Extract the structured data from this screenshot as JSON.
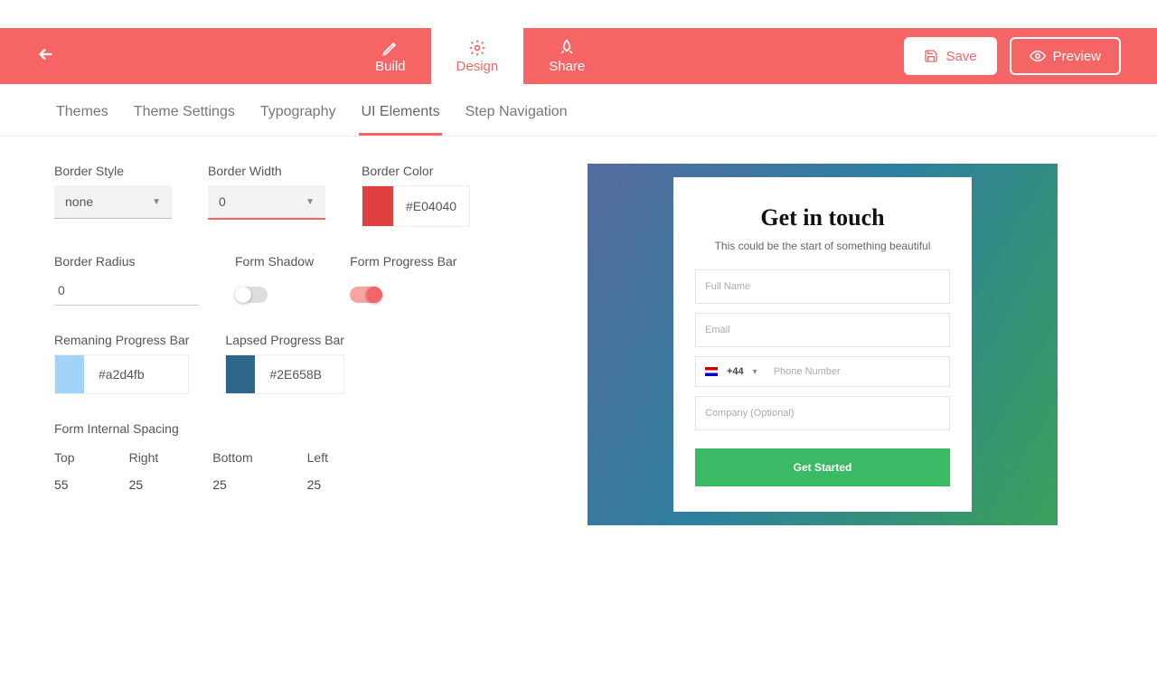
{
  "nav": {
    "tabs": {
      "build": "Build",
      "design": "Design",
      "share": "Share"
    },
    "save": "Save",
    "preview": "Preview"
  },
  "subnav": {
    "themes": "Themes",
    "theme_settings": "Theme Settings",
    "typography": "Typography",
    "ui_elements": "UI Elements",
    "step_navigation": "Step Navigation"
  },
  "fields": {
    "border_style": {
      "label": "Border Style",
      "value": "none"
    },
    "border_width": {
      "label": "Border Width",
      "value": "0"
    },
    "border_color": {
      "label": "Border Color",
      "hex": "#E04040",
      "swatch": "#e04040"
    },
    "border_radius": {
      "label": "Border Radius",
      "value": "0"
    },
    "form_shadow": {
      "label": "Form Shadow"
    },
    "form_progress": {
      "label": "Form Progress Bar"
    },
    "remaining_bar": {
      "label": "Remaning Progress Bar",
      "hex": "#a2d4fb",
      "swatch": "#a2d4fb"
    },
    "lapsed_bar": {
      "label": "Lapsed Progress Bar",
      "hex": "#2E658B",
      "swatch": "#2e658b"
    },
    "spacing": {
      "title": "Form Internal Spacing",
      "top": {
        "label": "Top",
        "value": "55"
      },
      "right": {
        "label": "Right",
        "value": "25"
      },
      "bottom": {
        "label": "Bottom",
        "value": "25"
      },
      "left": {
        "label": "Left",
        "value": "25"
      }
    }
  },
  "preview": {
    "title": "Get in touch",
    "subtitle": "This could be the start of something beautiful",
    "fullname": "Full Name",
    "email": "Email",
    "country_code": "+44",
    "phone": "Phone Number",
    "company": "Company (Optional)",
    "cta": "Get Started"
  }
}
